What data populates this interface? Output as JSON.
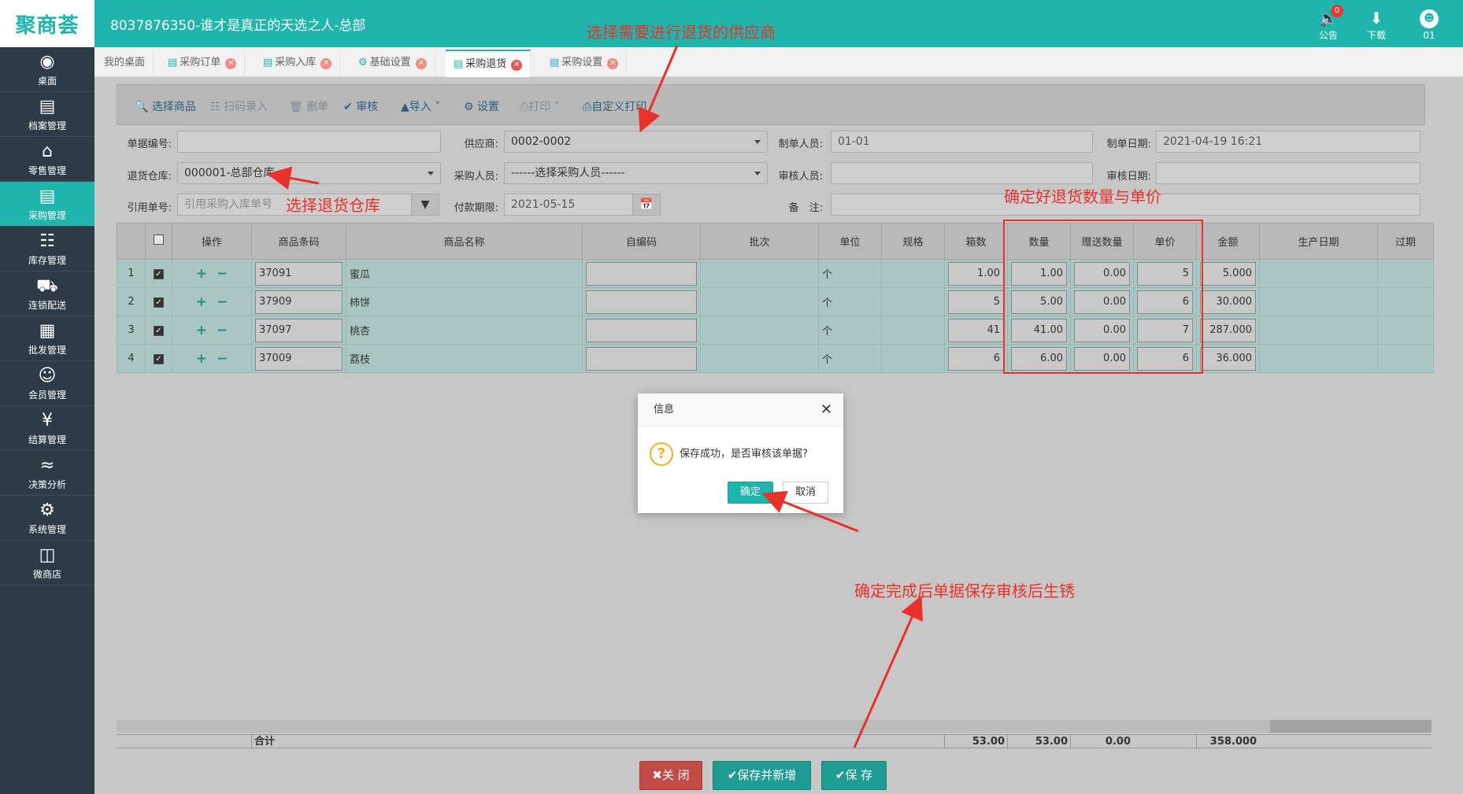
{
  "header": {
    "logo": "聚商荟",
    "title": "8037876350-谁才是真正的天选之人-总部",
    "notice_label": "公告",
    "notice_count": "0",
    "download_label": "下载",
    "user_label": "01"
  },
  "sidebar": {
    "items": [
      {
        "label": "桌面",
        "icon": "dashboard-icon"
      },
      {
        "label": "档案管理",
        "icon": "archive-icon"
      },
      {
        "label": "零售管理",
        "icon": "store-icon"
      },
      {
        "label": "采购管理",
        "icon": "purchase-icon",
        "active": true
      },
      {
        "label": "库存管理",
        "icon": "inventory-icon"
      },
      {
        "label": "连锁配送",
        "icon": "truck-icon"
      },
      {
        "label": "批发管理",
        "icon": "wholesale-icon"
      },
      {
        "label": "会员管理",
        "icon": "member-icon"
      },
      {
        "label": "结算管理",
        "icon": "settlement-icon"
      },
      {
        "label": "决策分析",
        "icon": "chart-icon"
      },
      {
        "label": "系统管理",
        "icon": "gear-icon"
      },
      {
        "label": "微商店",
        "icon": "shop-icon"
      }
    ]
  },
  "tabs": [
    {
      "label": "我的桌面",
      "closable": false
    },
    {
      "label": "采购订单",
      "closable": true
    },
    {
      "label": "采购入库",
      "closable": true
    },
    {
      "label": "基础设置",
      "closable": true
    },
    {
      "label": "采购退货",
      "closable": true,
      "active": true
    },
    {
      "label": "采购设置",
      "closable": true
    }
  ],
  "toolbar": {
    "select_goods": "选择商品",
    "scan_entry": "扫码录入",
    "delete_doc": "删单",
    "audit": "审核",
    "import": "导入",
    "settings": "设置",
    "print": "打印",
    "custom_print": "自定义打印"
  },
  "form": {
    "doc_no_label": "单据编号:",
    "doc_no_value": "",
    "supplier_label": "供应商:",
    "supplier_value": "0002-0002",
    "maker_label": "制单人员:",
    "maker_value": "01-01",
    "make_date_label": "制单日期:",
    "make_date_value": "2021-04-19 16:21",
    "warehouse_label": "退货仓库:",
    "warehouse_value": "000001-总部仓库",
    "buyer_label": "采购人员:",
    "buyer_value": "------选择采购人员------",
    "auditor_label": "审核人员:",
    "auditor_value": "",
    "audit_date_label": "审核日期:",
    "audit_date_value": "",
    "ref_no_label": "引用单号:",
    "ref_no_placeholder": "引用采购入库单号",
    "pay_due_label": "付款期限:",
    "pay_due_value": "2021-05-15",
    "remark_label": "备　注:",
    "remark_value": ""
  },
  "grid": {
    "headers": [
      "",
      "",
      "操作",
      "商品条码",
      "商品名称",
      "自编码",
      "批次",
      "单位",
      "规格",
      "箱数",
      "数量",
      "赠送数量",
      "单价",
      "金额",
      "生产日期",
      "过期"
    ],
    "rows": [
      {
        "no": "1",
        "barcode": "37091",
        "name": "蜜瓜",
        "code": "",
        "batch": "",
        "unit": "个",
        "spec": "",
        "boxes": "1.00",
        "qty": "1.00",
        "gift": "0.00",
        "price": "5",
        "amount": "5.000"
      },
      {
        "no": "2",
        "barcode": "37909",
        "name": "柿饼",
        "code": "",
        "batch": "",
        "unit": "个",
        "spec": "",
        "boxes": "5",
        "qty": "5.00",
        "gift": "0.00",
        "price": "6",
        "amount": "30.000"
      },
      {
        "no": "3",
        "barcode": "37097",
        "name": "桃杏",
        "code": "",
        "batch": "",
        "unit": "个",
        "spec": "",
        "boxes": "41",
        "qty": "41.00",
        "gift": "0.00",
        "price": "7",
        "amount": "287.000"
      },
      {
        "no": "4",
        "barcode": "37009",
        "name": "荔枝",
        "code": "",
        "batch": "",
        "unit": "个",
        "spec": "",
        "boxes": "6",
        "qty": "6.00",
        "gift": "0.00",
        "price": "6",
        "amount": "36.000"
      }
    ],
    "summary": {
      "label": "合计",
      "boxes": "53.00",
      "qty": "53.00",
      "gift": "0.00",
      "amount": "358.000"
    }
  },
  "bottom_buttons": {
    "close": "关 闭",
    "save_new": "保存并新增",
    "save": "保 存"
  },
  "modal": {
    "title": "信息",
    "message": "保存成功，是否审核该单据?",
    "ok": "确定",
    "cancel": "取消"
  },
  "annotations": {
    "supplier_note": "选择需要进行退货的供应商",
    "warehouse_note": "选择退货仓库",
    "qty_price_note": "确定好退货数量与单价",
    "confirm_note": "确定完成后单据保存审核后生锈"
  },
  "colors": {
    "accent": "#1fb5ad",
    "sidebar": "#2e3a47",
    "annotation": "#e8312b"
  }
}
